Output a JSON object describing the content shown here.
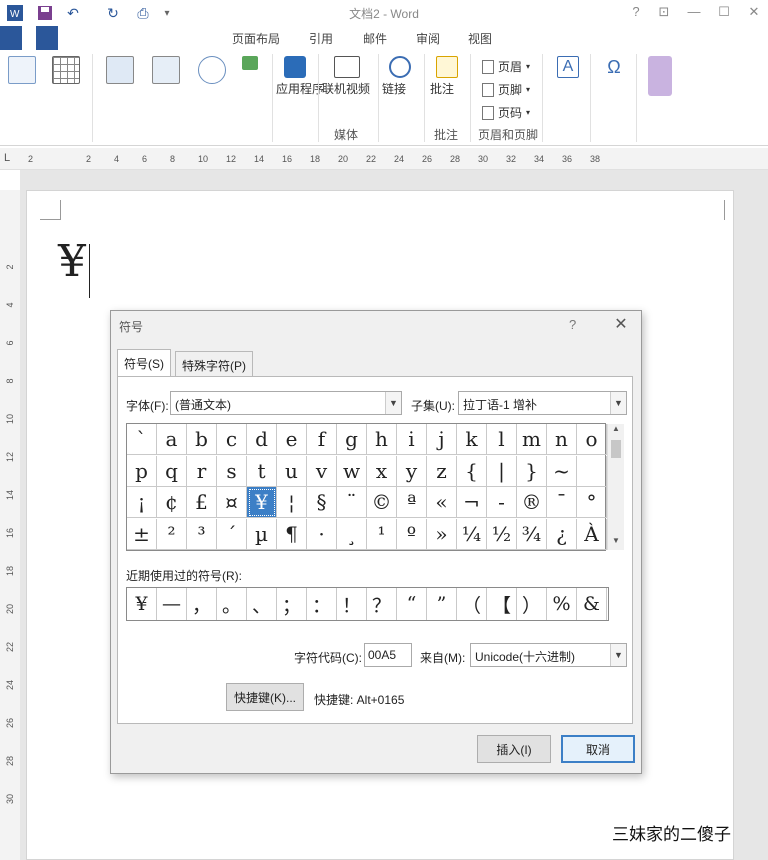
{
  "window": {
    "title": "文档2 - Word",
    "controls": [
      "?",
      "⊡",
      "—",
      "☐",
      "✕"
    ]
  },
  "ribbon": {
    "tabs": [
      "页面布局",
      "引用",
      "邮件",
      "审阅",
      "视图"
    ],
    "groups": {
      "apps_label": "应用程序",
      "online_video_label": "联机视频",
      "link_label": "链接",
      "comment_label": "批注",
      "header_label": "页眉",
      "footer_label": "页脚",
      "page_number_label": "页码",
      "media_group": "媒体",
      "comment_group": "批注",
      "header_footer_group": "页眉和页脚"
    }
  },
  "ruler": {
    "corner": "L",
    "numbers": [
      "2",
      "2",
      "4",
      "6",
      "8",
      "10",
      "12",
      "14",
      "16",
      "18",
      "20",
      "22",
      "24",
      "26",
      "28",
      "30",
      "32",
      "34",
      "36",
      "38"
    ]
  },
  "vruler": {
    "numbers": [
      "2",
      "4",
      "6",
      "8",
      "10",
      "12",
      "14",
      "16",
      "18",
      "20",
      "22",
      "24",
      "26",
      "28",
      "30"
    ]
  },
  "document": {
    "content": "¥"
  },
  "dialog": {
    "title": "符号",
    "help": "?",
    "close": "✕",
    "tabs": [
      "符号(S)",
      "特殊字符(P)"
    ],
    "font_label": "字体(F):",
    "font_value": "(普通文本)",
    "subset_label": "子集(U):",
    "subset_value": "拉丁语-1 增补",
    "symbols": [
      [
        "`",
        "a",
        "b",
        "c",
        "d",
        "e",
        "f",
        "g",
        "h",
        "i",
        "j",
        "k",
        "l",
        "m",
        "n",
        "o"
      ],
      [
        "p",
        "q",
        "r",
        "s",
        "t",
        "u",
        "v",
        "w",
        "x",
        "y",
        "z",
        "{",
        "|",
        "}",
        "~",
        ""
      ],
      [
        "¡",
        "¢",
        "£",
        "¤",
        "¥",
        "¦",
        "§",
        "¨",
        "©",
        "ª",
        "«",
        "¬",
        "-",
        "®",
        "¯",
        "°"
      ],
      [
        "±",
        "²",
        "³",
        "´",
        "µ",
        "¶",
        "·",
        "¸",
        "¹",
        "º",
        "»",
        "¼",
        "½",
        "¾",
        "¿",
        "À"
      ]
    ],
    "selected": {
      "row": 2,
      "col": 4
    },
    "recent_label": "近期使用过的符号(R):",
    "recent": [
      "¥",
      "—",
      "，",
      "。",
      "、",
      "；",
      "：",
      "！",
      "？",
      "“",
      "”",
      "（",
      "【",
      "）",
      "%",
      "&"
    ],
    "char_code_label": "字符代码(C):",
    "char_code": "00A5",
    "from_label": "来自(M):",
    "from_value": "Unicode(十六进制)",
    "shortcut_button": "快捷键(K)...",
    "shortcut_text": "快捷键: Alt+0165",
    "insert_button": "插入(I)",
    "cancel_button": "取消"
  },
  "watermark": "三妹家的二傻子"
}
